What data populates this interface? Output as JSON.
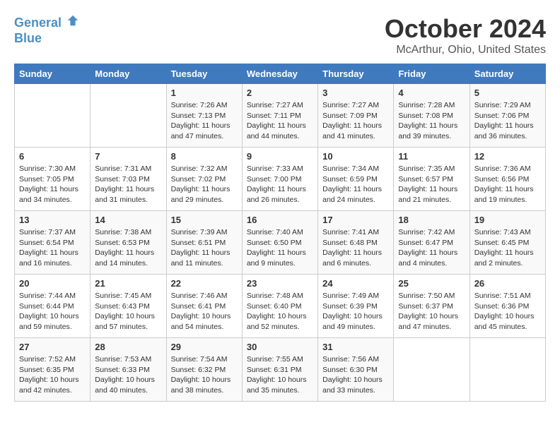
{
  "header": {
    "logo_line1": "General",
    "logo_line2": "Blue",
    "month": "October 2024",
    "location": "McArthur, Ohio, United States"
  },
  "days_of_week": [
    "Sunday",
    "Monday",
    "Tuesday",
    "Wednesday",
    "Thursday",
    "Friday",
    "Saturday"
  ],
  "weeks": [
    [
      {
        "day": "",
        "content": ""
      },
      {
        "day": "",
        "content": ""
      },
      {
        "day": "1",
        "content": "Sunrise: 7:26 AM\nSunset: 7:13 PM\nDaylight: 11 hours and 47 minutes."
      },
      {
        "day": "2",
        "content": "Sunrise: 7:27 AM\nSunset: 7:11 PM\nDaylight: 11 hours and 44 minutes."
      },
      {
        "day": "3",
        "content": "Sunrise: 7:27 AM\nSunset: 7:09 PM\nDaylight: 11 hours and 41 minutes."
      },
      {
        "day": "4",
        "content": "Sunrise: 7:28 AM\nSunset: 7:08 PM\nDaylight: 11 hours and 39 minutes."
      },
      {
        "day": "5",
        "content": "Sunrise: 7:29 AM\nSunset: 7:06 PM\nDaylight: 11 hours and 36 minutes."
      }
    ],
    [
      {
        "day": "6",
        "content": "Sunrise: 7:30 AM\nSunset: 7:05 PM\nDaylight: 11 hours and 34 minutes."
      },
      {
        "day": "7",
        "content": "Sunrise: 7:31 AM\nSunset: 7:03 PM\nDaylight: 11 hours and 31 minutes."
      },
      {
        "day": "8",
        "content": "Sunrise: 7:32 AM\nSunset: 7:02 PM\nDaylight: 11 hours and 29 minutes."
      },
      {
        "day": "9",
        "content": "Sunrise: 7:33 AM\nSunset: 7:00 PM\nDaylight: 11 hours and 26 minutes."
      },
      {
        "day": "10",
        "content": "Sunrise: 7:34 AM\nSunset: 6:59 PM\nDaylight: 11 hours and 24 minutes."
      },
      {
        "day": "11",
        "content": "Sunrise: 7:35 AM\nSunset: 6:57 PM\nDaylight: 11 hours and 21 minutes."
      },
      {
        "day": "12",
        "content": "Sunrise: 7:36 AM\nSunset: 6:56 PM\nDaylight: 11 hours and 19 minutes."
      }
    ],
    [
      {
        "day": "13",
        "content": "Sunrise: 7:37 AM\nSunset: 6:54 PM\nDaylight: 11 hours and 16 minutes."
      },
      {
        "day": "14",
        "content": "Sunrise: 7:38 AM\nSunset: 6:53 PM\nDaylight: 11 hours and 14 minutes."
      },
      {
        "day": "15",
        "content": "Sunrise: 7:39 AM\nSunset: 6:51 PM\nDaylight: 11 hours and 11 minutes."
      },
      {
        "day": "16",
        "content": "Sunrise: 7:40 AM\nSunset: 6:50 PM\nDaylight: 11 hours and 9 minutes."
      },
      {
        "day": "17",
        "content": "Sunrise: 7:41 AM\nSunset: 6:48 PM\nDaylight: 11 hours and 6 minutes."
      },
      {
        "day": "18",
        "content": "Sunrise: 7:42 AM\nSunset: 6:47 PM\nDaylight: 11 hours and 4 minutes."
      },
      {
        "day": "19",
        "content": "Sunrise: 7:43 AM\nSunset: 6:45 PM\nDaylight: 11 hours and 2 minutes."
      }
    ],
    [
      {
        "day": "20",
        "content": "Sunrise: 7:44 AM\nSunset: 6:44 PM\nDaylight: 10 hours and 59 minutes."
      },
      {
        "day": "21",
        "content": "Sunrise: 7:45 AM\nSunset: 6:43 PM\nDaylight: 10 hours and 57 minutes."
      },
      {
        "day": "22",
        "content": "Sunrise: 7:46 AM\nSunset: 6:41 PM\nDaylight: 10 hours and 54 minutes."
      },
      {
        "day": "23",
        "content": "Sunrise: 7:48 AM\nSunset: 6:40 PM\nDaylight: 10 hours and 52 minutes."
      },
      {
        "day": "24",
        "content": "Sunrise: 7:49 AM\nSunset: 6:39 PM\nDaylight: 10 hours and 49 minutes."
      },
      {
        "day": "25",
        "content": "Sunrise: 7:50 AM\nSunset: 6:37 PM\nDaylight: 10 hours and 47 minutes."
      },
      {
        "day": "26",
        "content": "Sunrise: 7:51 AM\nSunset: 6:36 PM\nDaylight: 10 hours and 45 minutes."
      }
    ],
    [
      {
        "day": "27",
        "content": "Sunrise: 7:52 AM\nSunset: 6:35 PM\nDaylight: 10 hours and 42 minutes."
      },
      {
        "day": "28",
        "content": "Sunrise: 7:53 AM\nSunset: 6:33 PM\nDaylight: 10 hours and 40 minutes."
      },
      {
        "day": "29",
        "content": "Sunrise: 7:54 AM\nSunset: 6:32 PM\nDaylight: 10 hours and 38 minutes."
      },
      {
        "day": "30",
        "content": "Sunrise: 7:55 AM\nSunset: 6:31 PM\nDaylight: 10 hours and 35 minutes."
      },
      {
        "day": "31",
        "content": "Sunrise: 7:56 AM\nSunset: 6:30 PM\nDaylight: 10 hours and 33 minutes."
      },
      {
        "day": "",
        "content": ""
      },
      {
        "day": "",
        "content": ""
      }
    ]
  ]
}
